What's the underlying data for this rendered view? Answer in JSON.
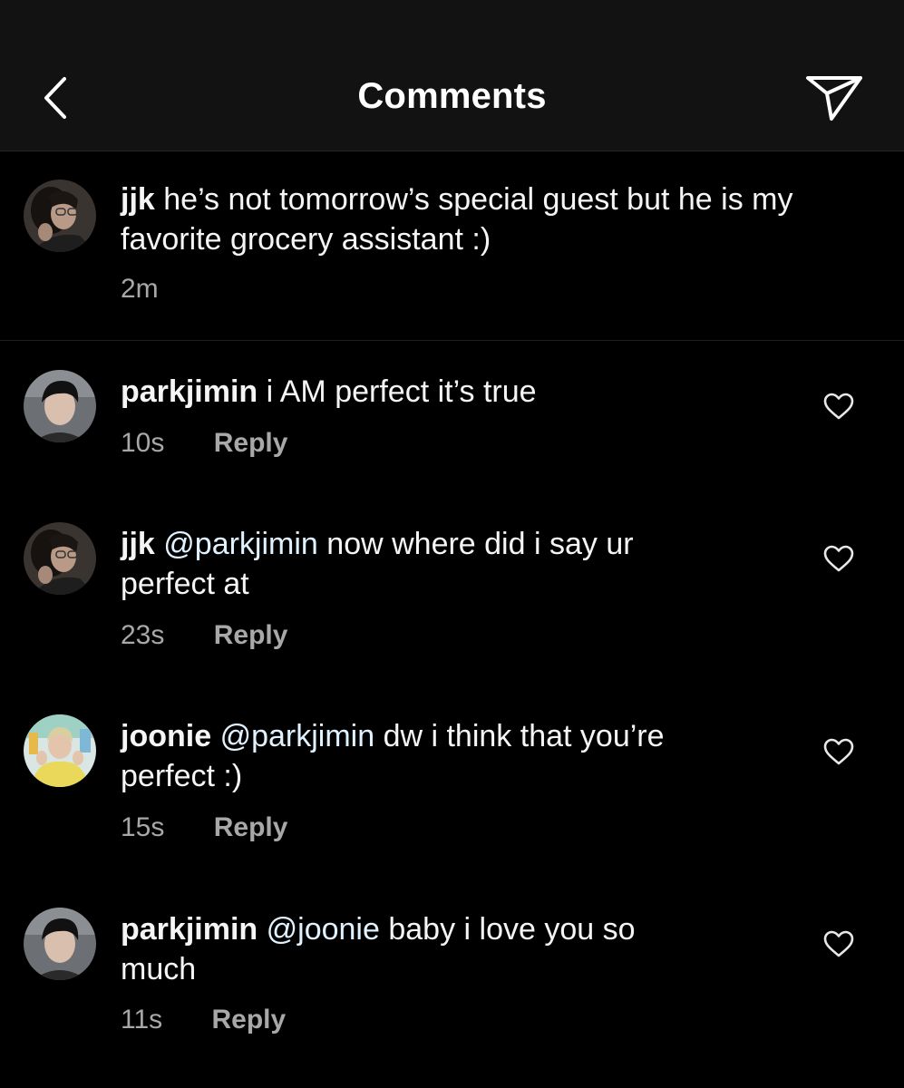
{
  "header": {
    "title": "Comments",
    "back_icon": "chevron-left-icon",
    "share_icon": "paper-plane-icon"
  },
  "caption": {
    "username": "jjk",
    "text": "he’s not tomorrow’s special guest but he is my favorite grocery assistant :)",
    "time": "2m"
  },
  "comments": [
    {
      "username": "parkjimin",
      "mention": "",
      "text": "i AM perfect it’s true",
      "time": "10s",
      "reply_label": "Reply"
    },
    {
      "username": "jjk",
      "mention": "@parkjimin",
      "text": "now where did i say ur perfect at",
      "time": "23s",
      "reply_label": "Reply"
    },
    {
      "username": "joonie",
      "mention": "@parkjimin",
      "text": "dw i think that you’re perfect :)",
      "time": "15s",
      "reply_label": "Reply"
    },
    {
      "username": "parkjimin",
      "mention": "@joonie",
      "text": "baby i love you so much",
      "time": "11s",
      "reply_label": "Reply"
    }
  ],
  "colors": {
    "background": "#000000",
    "header_bg": "#121212",
    "text": "#f5f5f5",
    "meta": "#a8a8a8",
    "mention": "#e0f1ff"
  }
}
